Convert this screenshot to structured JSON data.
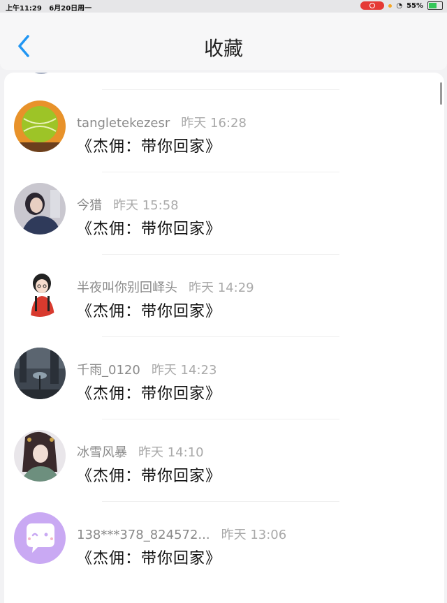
{
  "status_bar": {
    "time": "上午11:29",
    "date": "6月20日周一",
    "battery": "55%",
    "battery_level": 0.55
  },
  "header": {
    "title": "收藏"
  },
  "items": [
    {
      "username": "tangletekezesr",
      "time": "昨天 16:28",
      "content": "《杰佣：带你回家》",
      "avatar_icon": "tennis-ball-avatar"
    },
    {
      "username": "今猎",
      "time": "昨天 15:58",
      "content": "《杰佣：带你回家》",
      "avatar_icon": "girl-photo-avatar"
    },
    {
      "username": "半夜叫你别回峄头",
      "time": "昨天 14:29",
      "content": "《杰佣：带你回家》",
      "avatar_icon": "cartoon-girl-avatar"
    },
    {
      "username": "千雨_0120",
      "time": "昨天 14:23",
      "content": "《杰佣：带你回家》",
      "avatar_icon": "rainy-street-avatar"
    },
    {
      "username": "冰雪风暴",
      "time": "昨天 14:10",
      "content": "《杰佣：带你回家》",
      "avatar_icon": "ancient-style-girl-avatar"
    },
    {
      "username": "138***378_824572...",
      "time": "昨天 13:06",
      "content": "《杰佣：带你回家》",
      "avatar_icon": "default-chat-avatar"
    }
  ]
}
